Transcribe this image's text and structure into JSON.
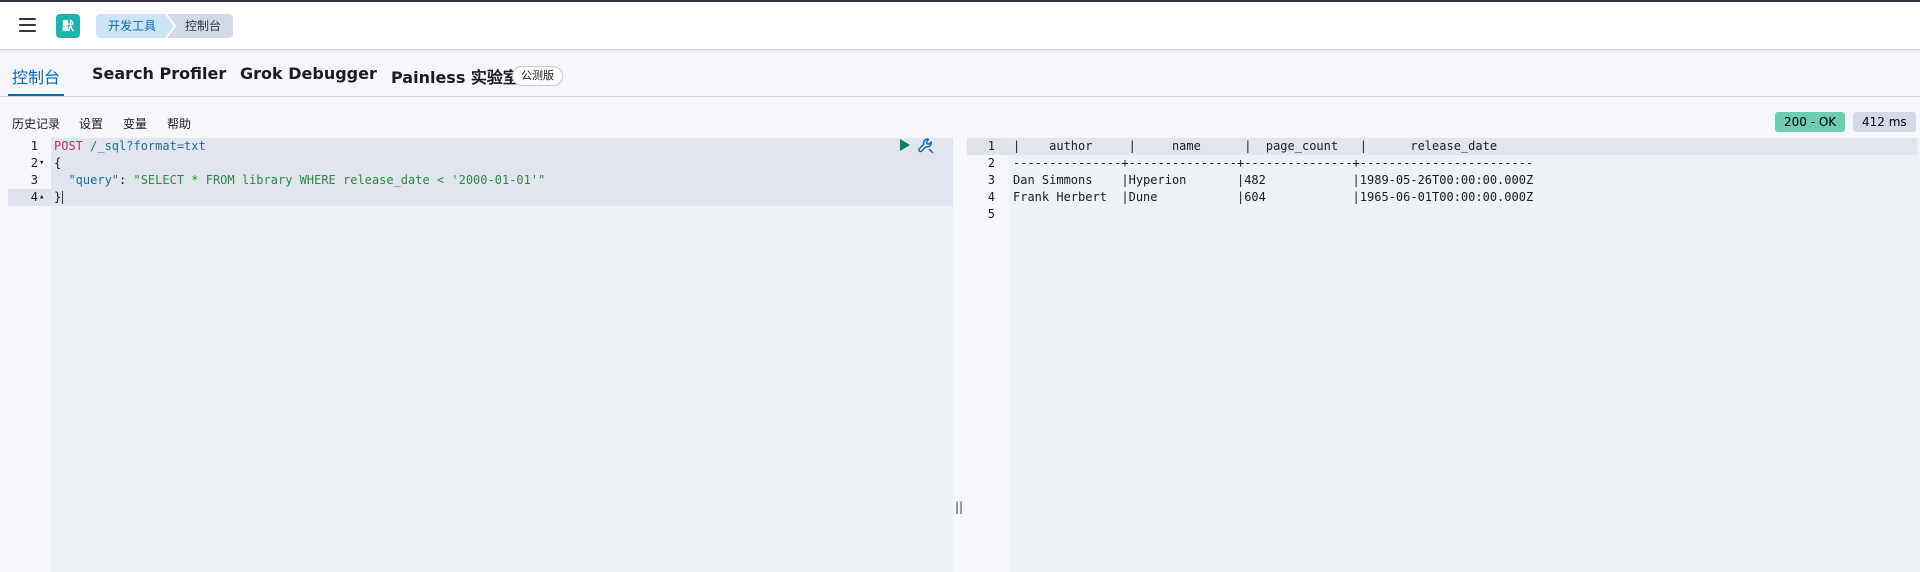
{
  "header": {
    "avatar_letter": "默",
    "breadcrumbs": [
      "开发工具",
      "控制台"
    ]
  },
  "tabs": [
    {
      "label": "控制台",
      "active": true
    },
    {
      "label": "Search Profiler",
      "active": false
    },
    {
      "label": "Grok Debugger",
      "active": false
    },
    {
      "label": "Painless 实验室",
      "active": false
    }
  ],
  "beta_badge": "公测版",
  "toolbar": {
    "items": [
      "历史记录",
      "设置",
      "变量",
      "帮助"
    ]
  },
  "response_status": "200 - OK",
  "response_time": "412 ms",
  "editor": {
    "line_numbers": [
      "1",
      "2",
      "3",
      "4"
    ],
    "fold_markers": [
      "",
      "▾",
      "",
      "▴"
    ],
    "lines": [
      {
        "method": "POST",
        "path": " /_sql?format=txt"
      },
      {
        "text": "{"
      },
      {
        "indent": "  ",
        "key": "\"query\"",
        "sep": ": ",
        "value": "\"SELECT * FROM library WHERE release_date < '2000-01-01'\""
      },
      {
        "text": "}"
      }
    ]
  },
  "output": {
    "line_numbers": [
      "1",
      "2",
      "3",
      "4",
      "5"
    ],
    "lines": [
      "|    author     |     name      |  page_count   |      release_date      ",
      "---------------+---------------+---------------+------------------------",
      "Dan Simmons    |Hyperion       |482            |1989-05-26T00:00:00.000Z",
      "Frank Herbert  |Dune           |604            |1965-06-01T00:00:00.000Z",
      ""
    ]
  },
  "colors": {
    "accent": "#006bb8",
    "status_ok": "#6dccb1",
    "avatar": "#20b2aa"
  }
}
